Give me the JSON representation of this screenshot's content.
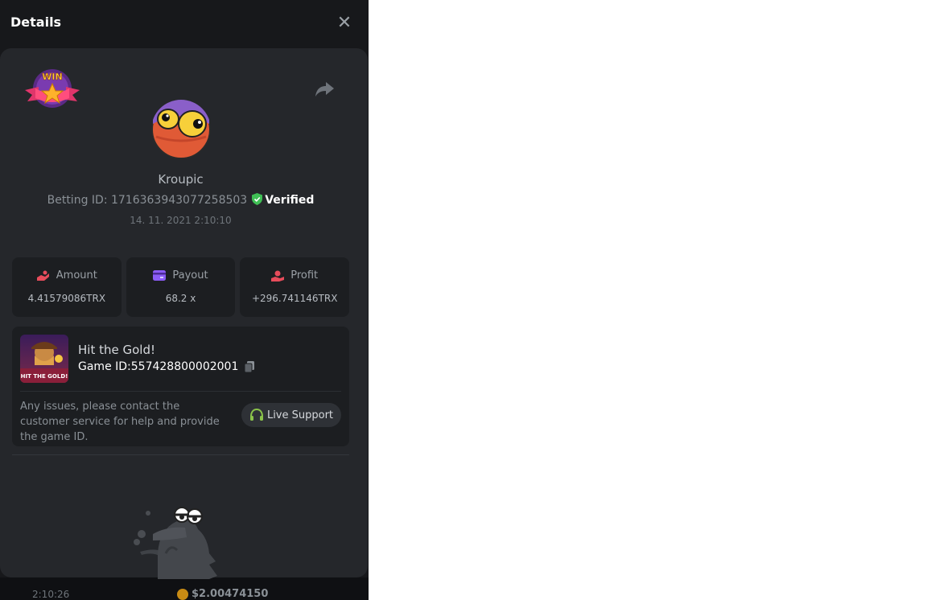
{
  "header": {
    "title": "Details",
    "close_icon": "close-icon"
  },
  "profile": {
    "username": "Kroupic",
    "betting_id_label": "Betting ID: 1716363943077258503",
    "verified_label": "Verified",
    "date": "14. 11. 2021 2:10:10"
  },
  "stats": [
    {
      "label": "Amount",
      "value": "4.41579086TRX",
      "icon": "hand-coin-icon",
      "color": "#e74c5b"
    },
    {
      "label": "Payout",
      "value": "68.2 x",
      "icon": "card-icon",
      "color": "#8b5cf6"
    },
    {
      "label": "Profit",
      "value": "+296.741146TRX",
      "icon": "profit-icon",
      "color": "#e74c5b"
    }
  ],
  "game": {
    "name": "Hit the Gold!",
    "id_label": "Game ID:557428800002001",
    "thumb_text": "HIT THE GOLD!",
    "help_text": "Any issues, please contact the customer service for help and provide the game ID.",
    "support_label": "Live Support"
  },
  "badge": {
    "text": "WIN"
  },
  "footer": {
    "time": "2:10:26",
    "amount": "$2.00474150"
  },
  "colors": {
    "verified": "#3fbf55",
    "support_icon": "#8bc34a"
  }
}
